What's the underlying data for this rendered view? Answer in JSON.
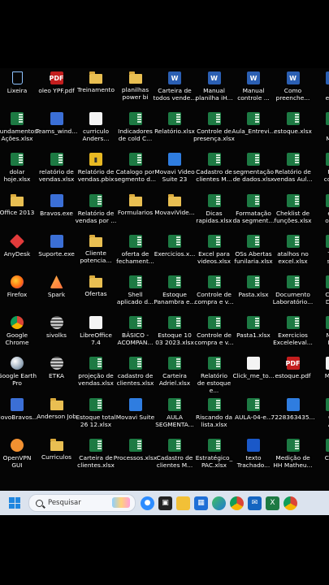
{
  "desktop": {
    "icons": [
      {
        "label": "Lixeira",
        "type": "recycle",
        "icon": "recycle-bin-icon"
      },
      {
        "label": "oleo YPF.pdf",
        "type": "pdf",
        "icon": "pdf-icon"
      },
      {
        "label": "Treinamento",
        "type": "folder",
        "icon": "folder-icon"
      },
      {
        "label": "planilhas\npower bi",
        "type": "folder",
        "icon": "folder-icon"
      },
      {
        "label": "Carteira de\ntodos vende...",
        "type": "word",
        "icon": "word-icon"
      },
      {
        "label": "Manual\nplanilha iH...",
        "type": "word",
        "icon": "word-icon"
      },
      {
        "label": "Manual\ncontrole ...",
        "type": "word",
        "icon": "word-icon"
      },
      {
        "label": "Como\npreenche...",
        "type": "word",
        "icon": "word-icon"
      },
      {
        "label": "Ex\nente",
        "type": "word",
        "icon": "word-icon"
      },
      {
        "label": "Fundamentos\nAções.xlsx",
        "type": "excel",
        "icon": "excel-icon"
      },
      {
        "label": "Teams_wind...",
        "type": "app",
        "icon": "teams-icon"
      },
      {
        "label": "curriculo\nAnders...",
        "type": "doc",
        "icon": "document-icon"
      },
      {
        "label": "Indicadores\nde cold C...",
        "type": "excel",
        "icon": "excel-icon"
      },
      {
        "label": "Relatório.xlsx",
        "type": "excel",
        "icon": "excel-icon"
      },
      {
        "label": "Controle de\npresença.xlsx",
        "type": "excel",
        "icon": "excel-icon"
      },
      {
        "label": "Aula_Entrevi...",
        "type": "excel",
        "icon": "excel-icon"
      },
      {
        "label": "estoque.xlsx",
        "type": "excel",
        "icon": "excel-icon"
      },
      {
        "label": "G\nMan",
        "type": "excel",
        "icon": "excel-icon"
      },
      {
        "label": "dolar\nhoje.xlsx",
        "type": "excel",
        "icon": "excel-icon"
      },
      {
        "label": "relatório de\nvendas.xlsx",
        "type": "excel",
        "icon": "excel-icon"
      },
      {
        "label": "Relatório de\nvendas.pbix",
        "type": "pbi",
        "icon": "power-bi-icon"
      },
      {
        "label": "Catalogo por\nsegmento d...",
        "type": "excel",
        "icon": "excel-icon"
      },
      {
        "label": "Movavi Video\nSuite 23",
        "type": "img",
        "icon": "movavi-icon"
      },
      {
        "label": "Cadastro de\nclientes M...",
        "type": "excel",
        "icon": "excel-icon"
      },
      {
        "label": "segmentação\nde dados.xlsx",
        "type": "excel",
        "icon": "excel-icon"
      },
      {
        "label": "Relatório de\nvendas Aul...",
        "type": "excel",
        "icon": "excel-icon"
      },
      {
        "label": "Fur\ncomb",
        "type": "excel",
        "icon": "excel-icon"
      },
      {
        "label": "Office 2013",
        "type": "folder",
        "icon": "folder-icon"
      },
      {
        "label": "Bravos.exe",
        "type": "app",
        "icon": "app-icon"
      },
      {
        "label": "Relatório de\nvendas por ...",
        "type": "excel",
        "icon": "excel-icon"
      },
      {
        "label": "Formularios",
        "type": "folder",
        "icon": "folder-icon"
      },
      {
        "label": "MovaviVide...",
        "type": "folder",
        "icon": "folder-icon"
      },
      {
        "label": "Dicas\nrapidas.xlsx",
        "type": "excel",
        "icon": "excel-icon"
      },
      {
        "label": "Formatação\nda segment...",
        "type": "excel",
        "icon": "excel-icon"
      },
      {
        "label": "Cheklist de\nfunções.xlsx",
        "type": "excel",
        "icon": "excel-icon"
      },
      {
        "label": "est\nobse",
        "type": "excel",
        "icon": "excel-icon"
      },
      {
        "label": "AnyDesk",
        "type": "anydesk",
        "icon": "anydesk-icon"
      },
      {
        "label": "Suporte.exe",
        "type": "app",
        "icon": "app-icon"
      },
      {
        "label": "Cliente\npotencia...",
        "type": "folder",
        "icon": "folder-icon"
      },
      {
        "label": "oferta de\nfechament...",
        "type": "excel",
        "icon": "excel-icon"
      },
      {
        "label": "Exercicios.x...",
        "type": "excel",
        "icon": "excel-icon"
      },
      {
        "label": "Excel para\nvideos.xlsx",
        "type": "excel",
        "icon": "excel-icon"
      },
      {
        "label": "OSs Abertas\nfunilaria.xlsx",
        "type": "excel",
        "icon": "excel-icon"
      },
      {
        "label": "atalhos no\nexcel.xlsx",
        "type": "excel",
        "icon": "excel-icon"
      },
      {
        "label": "Tre\nseg",
        "type": "excel",
        "icon": "excel-icon"
      },
      {
        "label": "Firefox",
        "type": "firefox",
        "icon": "firefox-icon"
      },
      {
        "label": "Spark",
        "type": "spark",
        "icon": "spark-icon"
      },
      {
        "label": "Ofertas",
        "type": "folder",
        "icon": "folder-icon"
      },
      {
        "label": "Shell\naplicado d...",
        "type": "excel",
        "icon": "excel-icon"
      },
      {
        "label": "Estoque\nPanambra e...",
        "type": "excel",
        "icon": "excel-icon"
      },
      {
        "label": "Controle de\ncompra e v...",
        "type": "excel",
        "icon": "excel-icon"
      },
      {
        "label": "Pasta.xlsx",
        "type": "excel",
        "icon": "excel-icon"
      },
      {
        "label": "Documento\nLaboratório...",
        "type": "excel",
        "icon": "excel-icon"
      },
      {
        "label": "COM\nDOS",
        "type": "excel",
        "icon": "excel-icon"
      },
      {
        "label": "Google\nChrome",
        "type": "chrome",
        "icon": "chrome-icon"
      },
      {
        "label": "sivolks",
        "type": "sivolks",
        "icon": "app-icon"
      },
      {
        "label": "LibreOffice\n7.4",
        "type": "doc",
        "icon": "libreoffice-icon"
      },
      {
        "label": "BÁSICO -\nACOMPAN...",
        "type": "excel",
        "icon": "excel-icon"
      },
      {
        "label": "Estoque 10\n03 2023.xlsx",
        "type": "excel",
        "icon": "excel-icon"
      },
      {
        "label": "Controle de\ncompra e v...",
        "type": "excel",
        "icon": "excel-icon"
      },
      {
        "label": "Pasta1.xlsx",
        "type": "excel",
        "icon": "excel-icon"
      },
      {
        "label": "Exercicios\nExceleleval...",
        "type": "excel",
        "icon": "excel-icon"
      },
      {
        "label": "Mec\nHH",
        "type": "excel",
        "icon": "excel-icon"
      },
      {
        "label": "Google Earth\nPro",
        "type": "earth",
        "icon": "google-earth-icon"
      },
      {
        "label": "ETKA",
        "type": "sivolks",
        "icon": "app-icon"
      },
      {
        "label": "projeção de\nvendas.xlsx",
        "type": "excel",
        "icon": "excel-icon"
      },
      {
        "label": "cadastro de\nclientes.xlsx",
        "type": "excel",
        "icon": "excel-icon"
      },
      {
        "label": "Carteira\nAdriel.xlsx",
        "type": "excel",
        "icon": "excel-icon"
      },
      {
        "label": "Relatório\nde estoque e...",
        "type": "excel",
        "icon": "excel-icon"
      },
      {
        "label": "Click_me_to...",
        "type": "doc",
        "icon": "document-icon"
      },
      {
        "label": "estoque.pdf",
        "type": "pdf",
        "icon": "pdf-icon"
      },
      {
        "label": "Math",
        "type": "doc",
        "icon": "document-icon"
      },
      {
        "label": "NovoBravos...",
        "type": "app",
        "icon": "app-icon"
      },
      {
        "label": "Anderson Job",
        "type": "folder",
        "icon": "folder-icon"
      },
      {
        "label": "Estoque total\n26 12.xlsx",
        "type": "excel",
        "icon": "excel-icon"
      },
      {
        "label": "Movavi Suite",
        "type": "img",
        "icon": "movavi-icon"
      },
      {
        "label": "AULA\nSEGMENTA...",
        "type": "excel",
        "icon": "excel-icon"
      },
      {
        "label": "Riscando da\nlista.xlsx",
        "type": "excel",
        "icon": "excel-icon"
      },
      {
        "label": "AULA-04-e...",
        "type": "excel",
        "icon": "excel-icon"
      },
      {
        "label": "7228363435...",
        "type": "img",
        "icon": "image-icon"
      },
      {
        "label": "Ch\nAB",
        "type": "excel",
        "icon": "excel-icon"
      },
      {
        "label": "OpenVPN\nGUI",
        "type": "openvpn",
        "icon": "openvpn-icon"
      },
      {
        "label": "Curriculos",
        "type": "folder",
        "icon": "folder-icon"
      },
      {
        "label": "Carteira de\nclientes.xlsx",
        "type": "excel",
        "icon": "excel-icon"
      },
      {
        "label": "Processos.xlsx",
        "type": "excel",
        "icon": "excel-icon"
      },
      {
        "label": "Cadastro de\nclientes M...",
        "type": "excel",
        "icon": "excel-icon"
      },
      {
        "label": "Estratégico_\nPAC.xlsx",
        "type": "excel",
        "icon": "excel-icon"
      },
      {
        "label": "texto\nTrachado...",
        "type": "bluedot",
        "icon": "app-icon"
      },
      {
        "label": "Medição de\nHH Matheu...",
        "type": "excel",
        "icon": "excel-icon"
      },
      {
        "label": "Conc",
        "type": "excel",
        "icon": "excel-icon"
      }
    ]
  },
  "taskbar": {
    "search_placeholder": "Pesquisar",
    "apps": [
      "zoom-icon",
      "task-view-icon",
      "file-explorer-icon",
      "store-icon",
      "edge-icon",
      "chrome-icon",
      "mail-icon",
      "excel-icon",
      "chrome-icon"
    ]
  }
}
